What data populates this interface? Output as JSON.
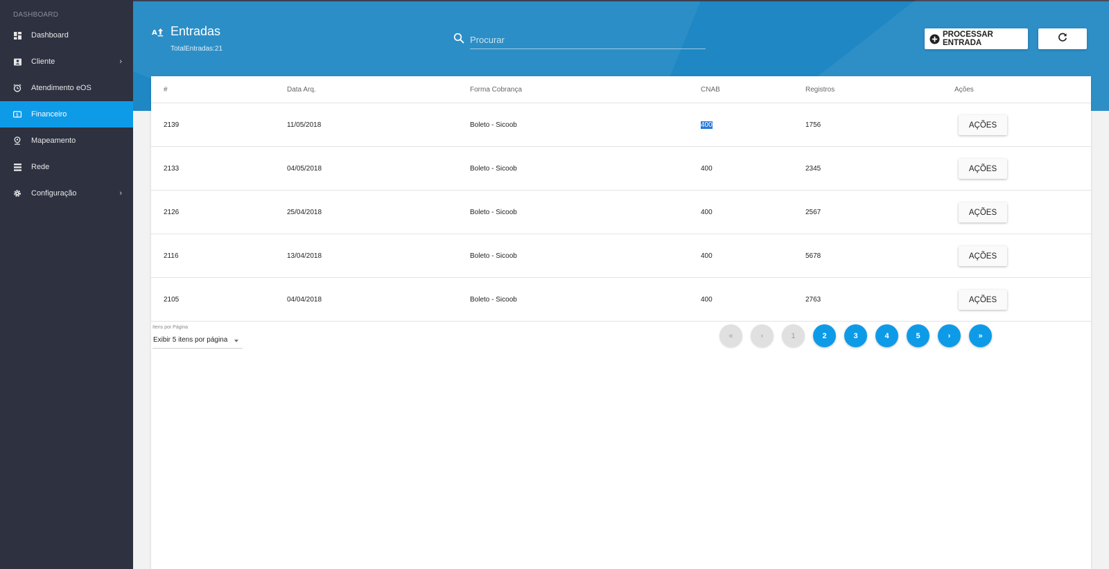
{
  "sidebar": {
    "header": "DASHBOARD",
    "items": [
      {
        "label": "Dashboard",
        "icon": "dashboard-icon"
      },
      {
        "label": "Cliente",
        "icon": "contact-card-icon",
        "has_submenu": true
      },
      {
        "label": "Atendimento eOS",
        "icon": "alarm-clock-icon"
      },
      {
        "label": "Financeiro",
        "icon": "money-icon",
        "active": true
      },
      {
        "label": "Mapeamento",
        "icon": "map-pin-icon"
      },
      {
        "label": "Rede",
        "icon": "server-rack-icon"
      },
      {
        "label": "Configuração",
        "icon": "gear-icon",
        "has_submenu": true
      }
    ]
  },
  "header": {
    "title": "Entradas",
    "subtitle": "TotalEntradas:21",
    "search_placeholder": "Procurar",
    "process_button": "PROCESSAR ENTRADA"
  },
  "table": {
    "columns": [
      "#",
      "Data Arq.",
      "Forma Cobrança",
      "CNAB",
      "Registros",
      "Ações"
    ],
    "rows": [
      {
        "id": "2139",
        "date": "11/05/2018",
        "forma": "Boleto - Sicoob",
        "cnab": "400",
        "registros": "1756",
        "acoes": "AÇÕES"
      },
      {
        "id": "2133",
        "date": "04/05/2018",
        "forma": "Boleto - Sicoob",
        "cnab": "400",
        "registros": "2345",
        "acoes": "AÇÕES"
      },
      {
        "id": "2126",
        "date": "25/04/2018",
        "forma": "Boleto - Sicoob",
        "cnab": "400",
        "registros": "2567",
        "acoes": "AÇÕES"
      },
      {
        "id": "2116",
        "date": "13/04/2018",
        "forma": "Boleto - Sicoob",
        "cnab": "400",
        "registros": "5678",
        "acoes": "AÇÕES"
      },
      {
        "id": "2105",
        "date": "04/04/2018",
        "forma": "Boleto - Sicoob",
        "cnab": "400",
        "registros": "2763",
        "acoes": "AÇÕES"
      }
    ]
  },
  "pagination": {
    "per_page_label": "Itens por Página",
    "per_page_value": "Exibir 5 itens por página",
    "first": "«",
    "prev": "‹",
    "pages": [
      "1",
      "2",
      "3",
      "4",
      "5"
    ],
    "current_page": "1",
    "next": "›",
    "last": "»"
  },
  "colors": {
    "sidebar_bg": "#2d3140",
    "accent": "#0d9be8",
    "banner": "#1f87c3"
  }
}
